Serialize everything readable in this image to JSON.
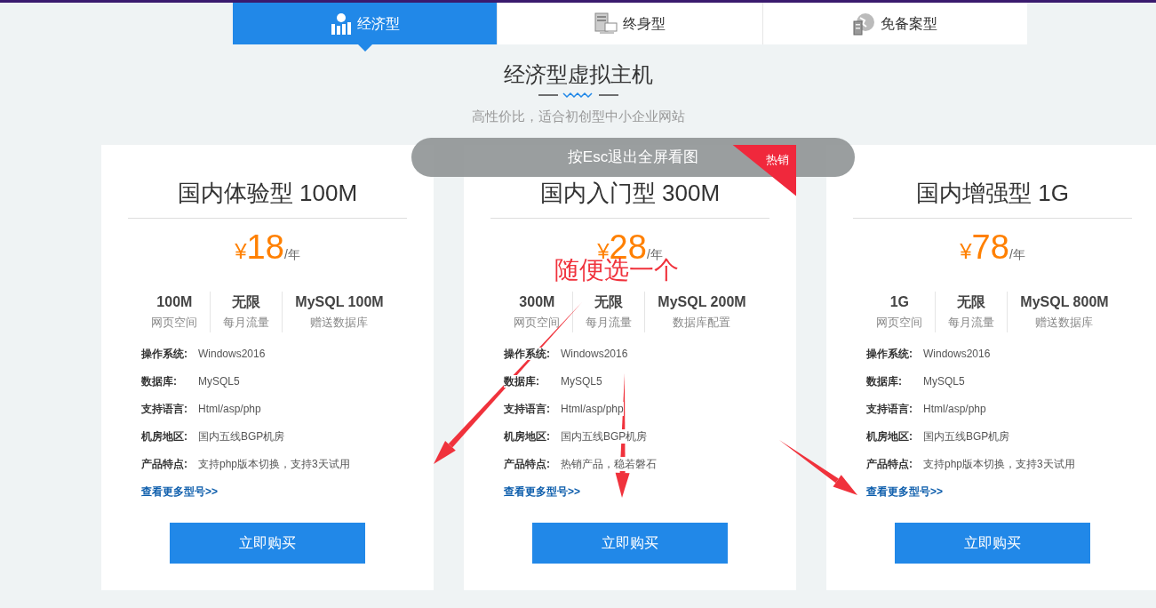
{
  "tabs": [
    {
      "label": "经济型",
      "selected": true
    },
    {
      "label": "终身型",
      "selected": false
    },
    {
      "label": "免备案型",
      "selected": false
    }
  ],
  "section": {
    "title": "经济型虚拟主机",
    "subtitle": "高性价比，适合初创型中小企业网站"
  },
  "plans": [
    {
      "name": "国内体验型 100M",
      "currency": "¥",
      "price": "18",
      "unit": "/年",
      "stats": [
        {
          "value": "100M",
          "label": "网页空间"
        },
        {
          "value": "无限",
          "label": "每月流量"
        },
        {
          "value": "MySQL 100M",
          "label": "赠送数据库"
        }
      ],
      "specs": [
        {
          "label": "操作系统:",
          "value": "Windows2016"
        },
        {
          "label": "数据库:",
          "value": "MySQL5"
        },
        {
          "label": "支持语言:",
          "value": "Html/asp/php"
        },
        {
          "label": "机房地区:",
          "value": "国内五线BGP机房"
        },
        {
          "label": "产品特点:",
          "value": "支持php版本切换，支持3天试用"
        }
      ],
      "more_link": "查看更多型号>>",
      "buy_button": "立即购买"
    },
    {
      "name": "国内入门型 300M",
      "currency": "¥",
      "price": "28",
      "unit": "/年",
      "badge": "热销",
      "stats": [
        {
          "value": "300M",
          "label": "网页空间"
        },
        {
          "value": "无限",
          "label": "每月流量"
        },
        {
          "value": "MySQL 200M",
          "label": "数据库配置"
        }
      ],
      "specs": [
        {
          "label": "操作系统:",
          "value": "Windows2016"
        },
        {
          "label": "数据库:",
          "value": "MySQL5"
        },
        {
          "label": "支持语言:",
          "value": "Html/asp/php"
        },
        {
          "label": "机房地区:",
          "value": "国内五线BGP机房"
        },
        {
          "label": "产品特点:",
          "value": "热销产品，稳若磐石"
        }
      ],
      "more_link": "查看更多型号>>",
      "buy_button": "立即购买"
    },
    {
      "name": "国内增强型 1G",
      "currency": "¥",
      "price": "78",
      "unit": "/年",
      "stats": [
        {
          "value": "1G",
          "label": "网页空间"
        },
        {
          "value": "无限",
          "label": "每月流量"
        },
        {
          "value": "MySQL 800M",
          "label": "赠送数据库"
        }
      ],
      "specs": [
        {
          "label": "操作系统:",
          "value": "Windows2016"
        },
        {
          "label": "数据库:",
          "value": "MySQL5"
        },
        {
          "label": "支持语言:",
          "value": "Html/asp/php"
        },
        {
          "label": "机房地区:",
          "value": "国内五线BGP机房"
        },
        {
          "label": "产品特点:",
          "value": "支持php版本切换，支持3天试用"
        }
      ],
      "more_link": "查看更多型号>>",
      "buy_button": "立即购买"
    }
  ],
  "fullscreen_hint": "按Esc退出全屏看图",
  "annotation": {
    "text": "随便选一个"
  }
}
